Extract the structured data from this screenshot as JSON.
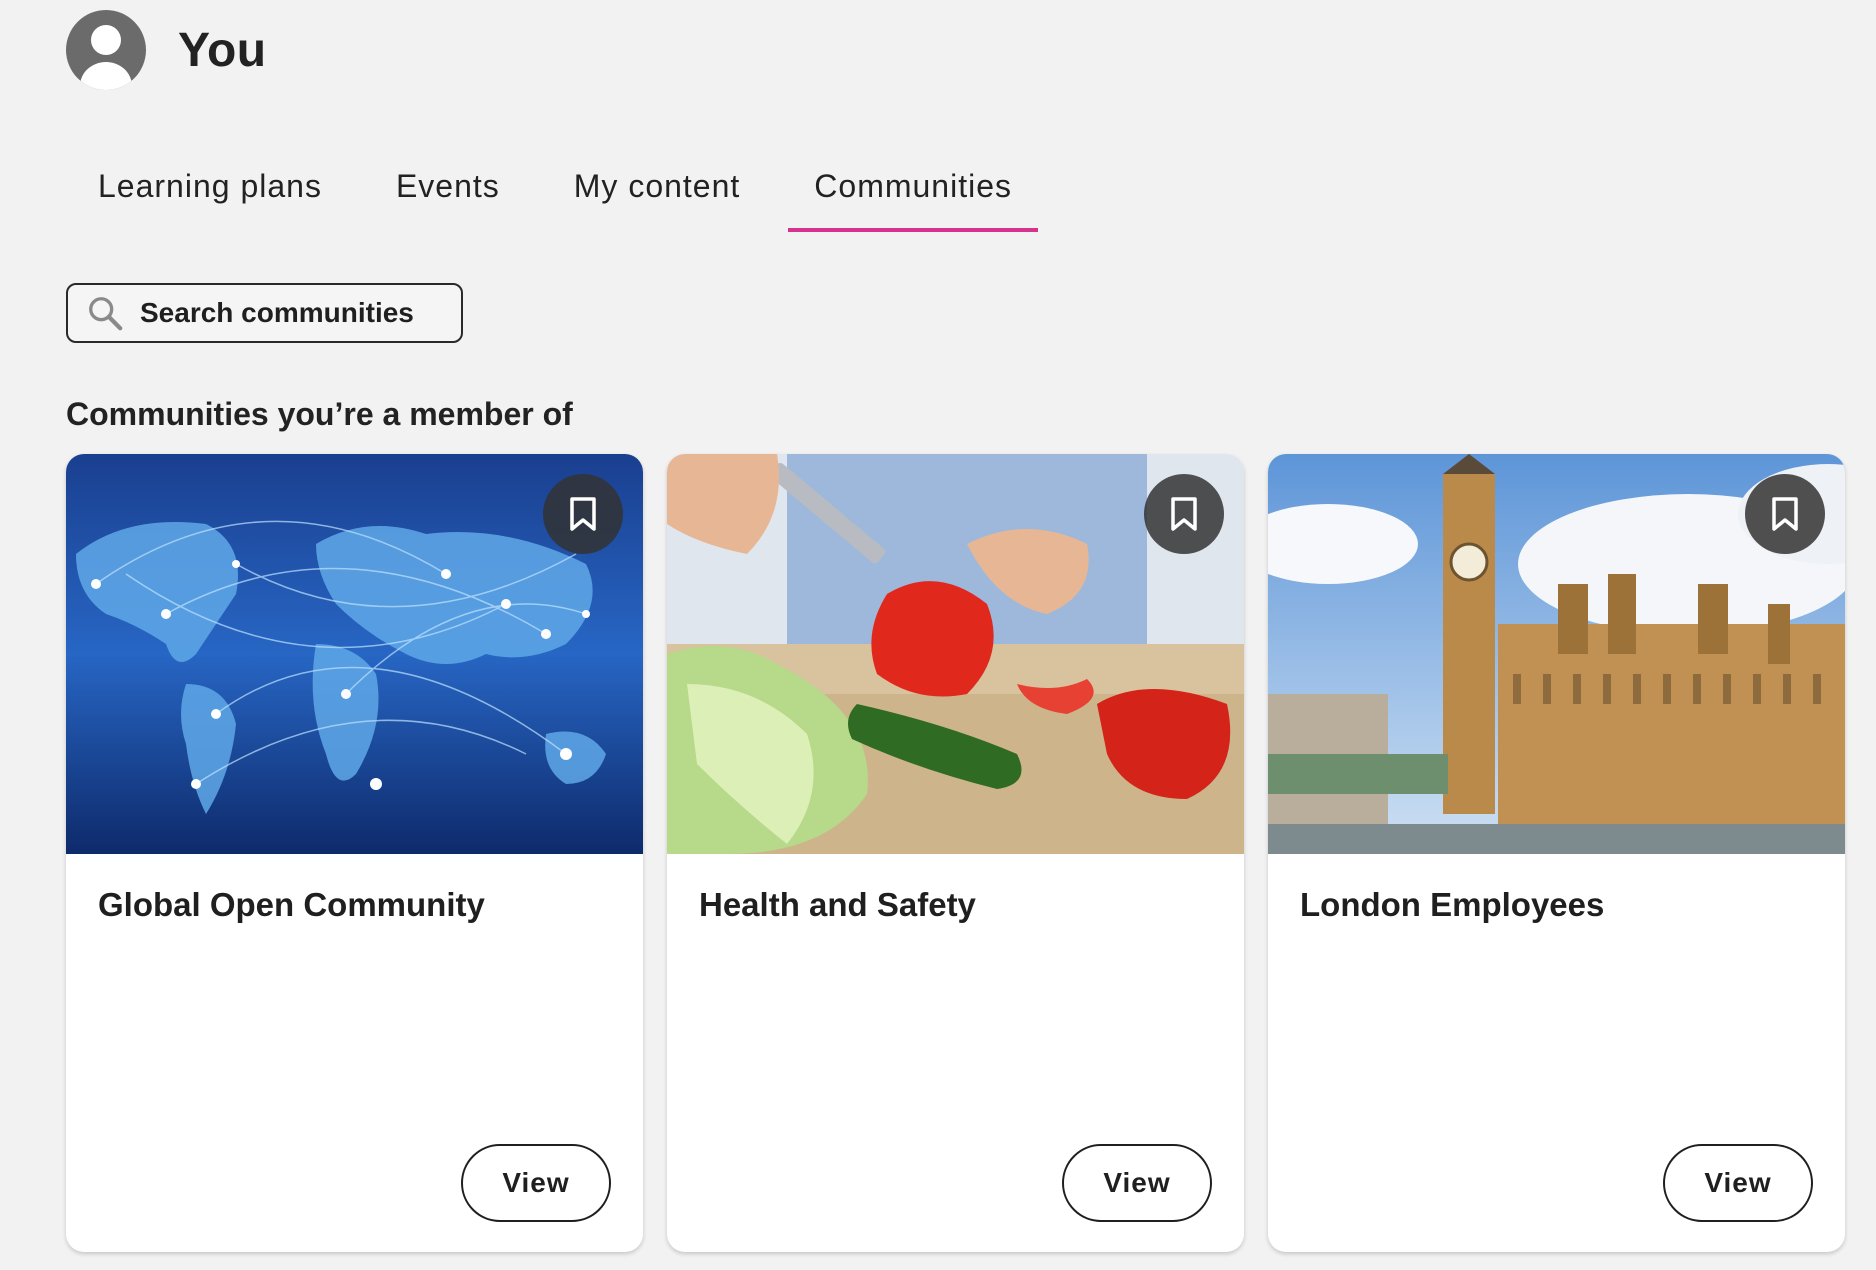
{
  "user": {
    "name": "You",
    "avatar_icon": "user-avatar-icon"
  },
  "tabs": [
    {
      "label": "Learning plans",
      "active": false
    },
    {
      "label": "Events",
      "active": false
    },
    {
      "label": "My content",
      "active": false
    },
    {
      "label": "Communities",
      "active": true
    }
  ],
  "accent_color": "#d6338f",
  "search": {
    "placeholder": "Search communities",
    "value": "",
    "icon": "search-icon"
  },
  "section": {
    "title": "Communities you’re a member of"
  },
  "communities": [
    {
      "title": "Global Open Community",
      "image": "world-network-map",
      "bookmark_icon": "bookmark-icon",
      "button_label": "View"
    },
    {
      "title": "Health and Safety",
      "image": "cutting-vegetables",
      "bookmark_icon": "bookmark-icon",
      "button_label": "View"
    },
    {
      "title": "London Employees",
      "image": "big-ben-parliament",
      "bookmark_icon": "bookmark-icon",
      "button_label": "View"
    }
  ]
}
